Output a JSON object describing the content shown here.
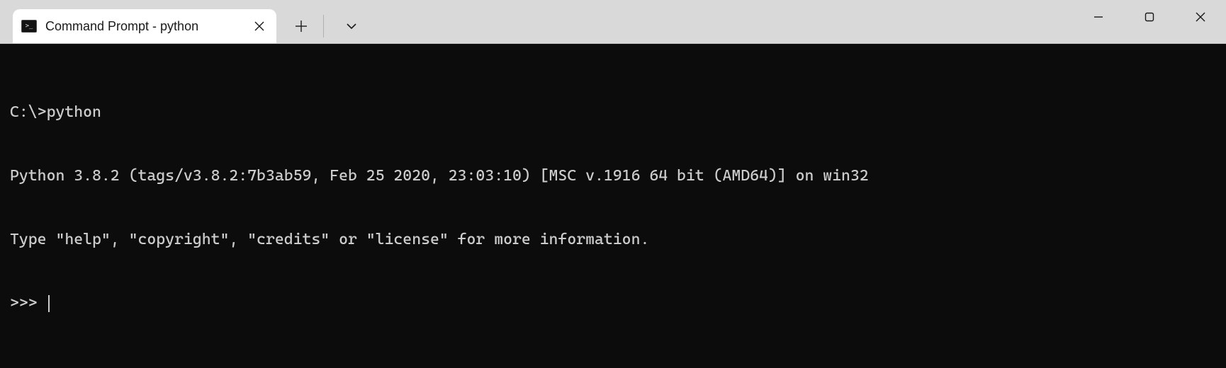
{
  "titlebar": {
    "tab": {
      "icon_name": "terminal-icon",
      "icon_glyph": ">_",
      "title": "Command Prompt - python"
    },
    "new_tab_tooltip": "New tab",
    "tabs_menu_tooltip": "Tab actions",
    "minimize_tooltip": "Minimize",
    "maximize_tooltip": "Maximize",
    "close_tooltip": "Close"
  },
  "terminal": {
    "lines": [
      "C:\\>python",
      "Python 3.8.2 (tags/v3.8.2:7b3ab59, Feb 25 2020, 23:03:10) [MSC v.1916 64 bit (AMD64)] on win32",
      "Type \"help\", \"copyright\", \"credits\" or \"license\" for more information."
    ],
    "prompt": ">>> "
  }
}
